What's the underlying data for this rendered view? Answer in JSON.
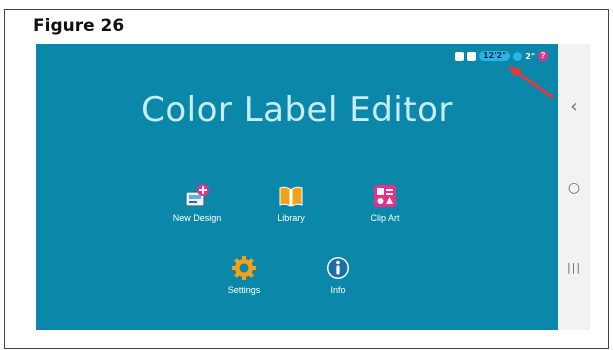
{
  "figure_title": "Figure 26",
  "status_bar": {
    "tape_width": "12'2\"",
    "tape_length": "2\"",
    "help_glyph": "?"
  },
  "app_title": "Color Label Editor",
  "tiles": [
    {
      "label": "New Design",
      "icon": "new-design-icon"
    },
    {
      "label": "Library",
      "icon": "library-book-icon"
    },
    {
      "label": "Clip Art",
      "icon": "clip-art-icon"
    },
    {
      "label": "Settings",
      "icon": "settings-gear-icon"
    },
    {
      "label": "Info",
      "icon": "info-icon"
    }
  ],
  "nav": {
    "back_glyph": "‹",
    "home_glyph": "○",
    "recents_glyph": "|||"
  },
  "colors": {
    "screen_bg": "#0a87a9",
    "arrow": "#e23a3a",
    "pink_accent": "#e8308a",
    "orange": "#f2a21a"
  }
}
